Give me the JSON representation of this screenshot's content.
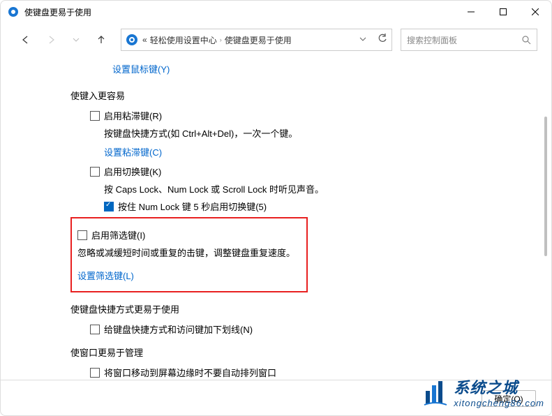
{
  "window": {
    "title": "使键盘更易于使用"
  },
  "breadcrumb": {
    "prefix": "«",
    "part1": "轻松使用设置中心",
    "part2": "使键盘更易于使用"
  },
  "search": {
    "placeholder": "搜索控制面板"
  },
  "content": {
    "top_link": "设置鼠标键(Y)",
    "section1_title": "使键入更容易",
    "sticky": {
      "label": "启用粘滞键(R)",
      "desc": "按键盘快捷方式(如 Ctrl+Alt+Del)，一次一个键。",
      "link": "设置粘滞键(C)"
    },
    "toggle": {
      "label": "启用切换键(K)",
      "desc": "按 Caps Lock、Num Lock 或 Scroll Lock 时听见声音。",
      "sub_label": "按住 Num Lock 键 5 秒启用切换键(5)"
    },
    "filter": {
      "label": "启用筛选键(I)",
      "desc": "忽略或减缓短时间或重复的击键，调整键盘重复速度。",
      "link": "设置筛选键(L)"
    },
    "section2_title": "使键盘快捷方式更易于使用",
    "underline": {
      "label": "给键盘快捷方式和访问键加下划线(N)"
    },
    "section3_title": "使窗口更易于管理",
    "window_mgmt": {
      "label": "将窗口移动到屏幕边缘时不要自动排列窗口"
    }
  },
  "footer": {
    "ok": "确定(O)"
  },
  "watermark": {
    "main": "系统之城",
    "sub": "xitongcheng86.com"
  }
}
